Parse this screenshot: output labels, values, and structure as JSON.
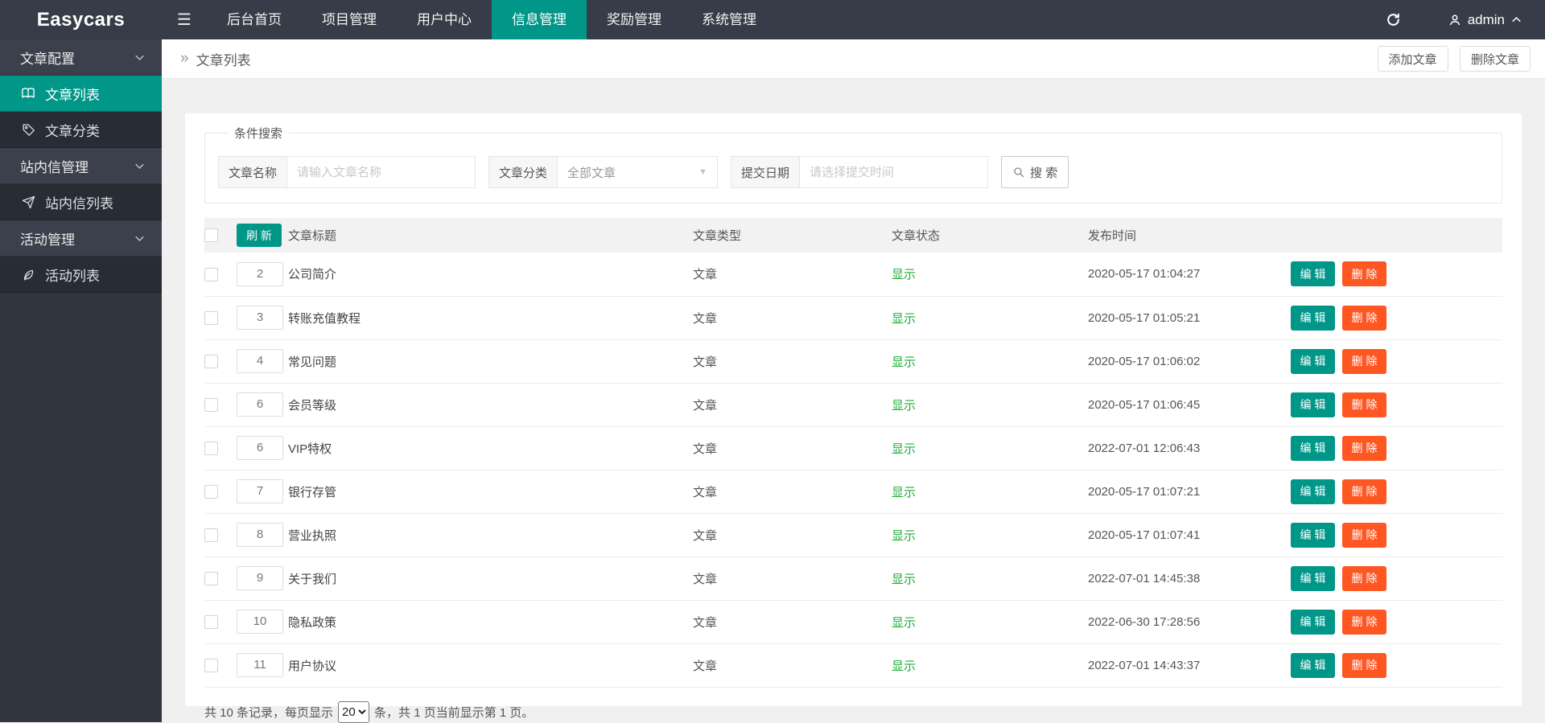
{
  "colors": {
    "accent": "#009688",
    "danger": "#ff5722",
    "status_green": "#22ac38",
    "navbar_bg": "#373d48",
    "sidebar_group_bg": "#3b404c",
    "sidebar_item_bg": "#282d35"
  },
  "navbar": {
    "logo": "Easycars",
    "menu_toggle_icon": "hamburger-icon",
    "items": [
      {
        "label": "后台首页",
        "active": false
      },
      {
        "label": "项目管理",
        "active": false
      },
      {
        "label": "用户中心",
        "active": false
      },
      {
        "label": "信息管理",
        "active": true
      },
      {
        "label": "奖励管理",
        "active": false
      },
      {
        "label": "系统管理",
        "active": false
      }
    ],
    "refresh_icon": "refresh-icon",
    "user": {
      "icon": "user-icon",
      "name": "admin",
      "chevron": "chevron-up-icon"
    }
  },
  "sidebar": {
    "items": [
      {
        "type": "group",
        "label": "文章配置",
        "chevron": "chevron-down-icon"
      },
      {
        "type": "item",
        "label": "文章列表",
        "icon": "book-icon",
        "active": true
      },
      {
        "type": "item",
        "label": "文章分类",
        "icon": "tag-icon",
        "active": false
      },
      {
        "type": "group",
        "label": "站内信管理",
        "chevron": "chevron-down-icon"
      },
      {
        "type": "item",
        "label": "站内信列表",
        "icon": "send-icon",
        "active": false
      },
      {
        "type": "group",
        "label": "活动管理",
        "chevron": "chevron-down-icon"
      },
      {
        "type": "item",
        "label": "活动列表",
        "icon": "leaf-icon",
        "active": false
      }
    ]
  },
  "breadcrumb": {
    "icon": "double-chevron-icon",
    "title": "文章列表"
  },
  "page_actions": {
    "add_label": "添加文章",
    "delete_label": "删除文章"
  },
  "search": {
    "legend": "条件搜索",
    "name_label": "文章名称",
    "name_placeholder": "请输入文章名称",
    "category_label": "文章分类",
    "category_value": "全部文章",
    "date_label": "提交日期",
    "date_placeholder": "请选择提交时间",
    "search_button": "搜 索",
    "search_icon": "magnifier-icon"
  },
  "table": {
    "refresh_label": "刷 新",
    "headers": {
      "title": "文章标题",
      "type": "文章类型",
      "status": "文章状态",
      "time": "发布时间"
    },
    "edit_label": "编 辑",
    "delete_label": "删 除",
    "rows": [
      {
        "id": "2",
        "title": "公司简介",
        "type": "文章",
        "status": "显示",
        "time": "2020-05-17 01:04:27"
      },
      {
        "id": "3",
        "title": "转账充值教程",
        "type": "文章",
        "status": "显示",
        "time": "2020-05-17 01:05:21"
      },
      {
        "id": "4",
        "title": "常见问题",
        "type": "文章",
        "status": "显示",
        "time": "2020-05-17 01:06:02"
      },
      {
        "id": "6",
        "title": "会员等级",
        "type": "文章",
        "status": "显示",
        "time": "2020-05-17 01:06:45"
      },
      {
        "id": "6",
        "title": "VIP特权",
        "type": "文章",
        "status": "显示",
        "time": "2022-07-01 12:06:43"
      },
      {
        "id": "7",
        "title": "银行存管",
        "type": "文章",
        "status": "显示",
        "time": "2020-05-17 01:07:21"
      },
      {
        "id": "8",
        "title": "营业执照",
        "type": "文章",
        "status": "显示",
        "time": "2020-05-17 01:07:41"
      },
      {
        "id": "9",
        "title": "关于我们",
        "type": "文章",
        "status": "显示",
        "time": "2022-07-01 14:45:38"
      },
      {
        "id": "10",
        "title": "隐私政策",
        "type": "文章",
        "status": "显示",
        "time": "2022-06-30 17:28:56"
      },
      {
        "id": "11",
        "title": "用户协议",
        "type": "文章",
        "status": "显示",
        "time": "2022-07-01 14:43:37"
      }
    ]
  },
  "pagination": {
    "prefix": "共 10 条记录，每页显示",
    "per_page": "20",
    "suffix": "条，共 1 页当前显示第 1 页。"
  }
}
